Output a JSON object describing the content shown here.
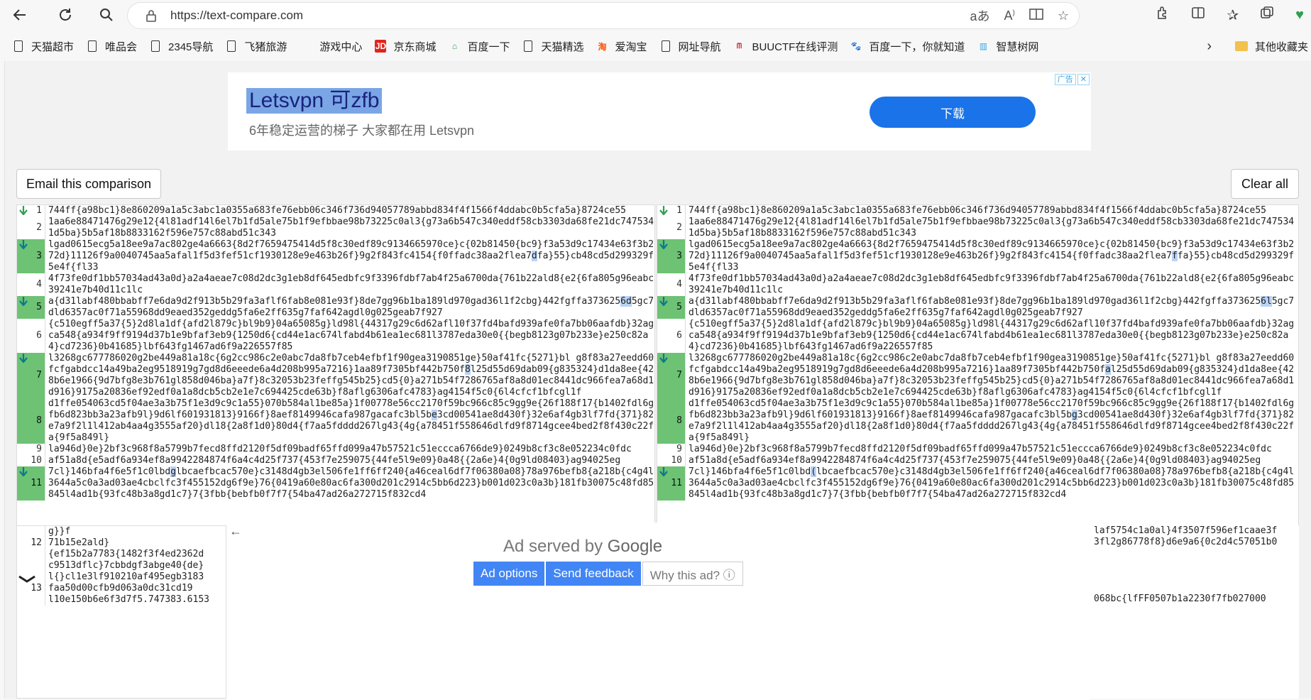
{
  "browser": {
    "url": "https://text-compare.com",
    "bookmarks": [
      "天猫超市",
      "唯品会",
      "2345导航",
      "飞猪旅游",
      "游戏中心",
      "京东商城",
      "百度一下",
      "天猫精选",
      "爱淘宝",
      "网址导航",
      "BUUCTF在线评测",
      "百度一下，你就知道",
      "智慧树网"
    ],
    "other_bookmarks": "其他收藏夹",
    "address_icons": [
      "read-aloud-icon",
      "font-icon",
      "split-screen-icon",
      "favorite-star-icon"
    ],
    "toolbar_icons": [
      "extensions-icon",
      "split-view-icon",
      "favorites-icon",
      "collections-icon",
      "performance-icon"
    ]
  },
  "top_ad": {
    "title": "Letsvpn 可zfb",
    "subtitle": "6年稳定运营的梯子 大家都在用 Letsvpn",
    "button": "下载",
    "badge": "广告"
  },
  "buttons": {
    "email": "Email this comparison",
    "clear": "Clear all"
  },
  "diff": {
    "left": [
      {
        "n": "1",
        "changed": false,
        "arrow": "down",
        "pre": "744ff{a98bc1}8e860209a1a5c3abc1a0355a683fe76ebb06c346f736d94057789abbd834f4f1566f4ddabc0b5cfa5a}8724ce55",
        "hl": "",
        "post": ""
      },
      {
        "n": "2",
        "changed": false,
        "arrow": "",
        "pre": "1aa6e88471476g29e12{4l81adf14l6el7b1fd5ale75b1f9efbbae98b73225c0al3{g73a6b547c340eddf58cb3303da68fe21dc7475341d5ba}5b5af18b8833162f596e757c88abd51c343",
        "hl": "",
        "post": ""
      },
      {
        "n": "3",
        "changed": true,
        "arrow": "down",
        "pre": "lgad0615ecg5a18ee9a7ac802ge4a6663{8d2f7659475414d5f8c30edf89c9134665970ce}c{02b81450{bc9}f3a53d9c17434e63f3b272d}11126f9a0040745aa5afal1f5d3fef51cf1930128e9e463b26f}9g2f843fc4154{f0ffadc38aa2flea7",
        "hl": "d",
        "post": "fa}55}cb48cd5d299329f5e4f{fl33"
      },
      {
        "n": "4",
        "changed": false,
        "arrow": "",
        "pre": "4f73fe0df1bb57034ad43a0d}a2a4aeae7c08d2dc3g1eb8df645edbfc9f3396fdbf7ab4f25a6700da{761b22ald8{e2{6fa805g96eabc39241e7b40d11c1lc",
        "hl": "",
        "post": ""
      },
      {
        "n": "5",
        "changed": true,
        "arrow": "down",
        "pre": "a{d31labf480bbabff7e6da9d2f913b5b29fa3aflf6fab8e081e93f}8de7gg96b1ba189ld970gad36l1f2cbg}442fgffa373625",
        "hl": "6d",
        "post": "5gc7dld6357ac0f71a55968dd9eaed352geddg5fa6e2ff635g7faf642agdl0g025geab7f927"
      },
      {
        "n": "6",
        "changed": false,
        "arrow": "",
        "pre": "{c510egff5a37{5}2d8la1df{afd2l879c}bl9b9}04a65085g}ld98l{44317g29c6d62afl10f37fd4bafd939afe0fa7bb06aafdb}32agca548{a934f9ff9194d37b1e9bfaf3eb9{1250d6{cd44e1ac674lfabd4b61ea1ec681l3787eda30e0{{begb8123g07b233e}e250c82a4}cd7236}0b41685}lbf643fg1467ad6f9a226557f85",
        "hl": "",
        "post": ""
      },
      {
        "n": "7",
        "changed": true,
        "arrow": "down",
        "pre": "l3268gc677786020g2be449a81a18c{6g2cc986c2e0abc7da8fb7ceb4efbf1f90gea3190851ge}50af41fc{5271}bl g8f83a27eedd60fcfgabdcc14a49ba2eg9518919g7gd8d6eeede6a4d208b995a7216}1aa89f7305bf442b750f",
        "hl": "8",
        "post": "l25d55d69dab09{g835324}d1da8ee{428b6e1966{9d7bfg8e3b761gl858d046ba}a7f}8c32053b23feffg545b25}cd5{0}a271b54f7286765af8a8d01ec8441dc966fea7a68d1d916}9175a20836ef92edf0a1a8dcb5cb2e1e7c694425cde63b}f8aflg6306afc4783}ag4154f5c0{6l4cfcf1bfcgl1f"
      },
      {
        "n": "8",
        "changed": true,
        "arrow": "",
        "pre": "d1ffe054063cd5f04ae3a3b75f1e3d9c9c1a55}070b584al1be85a}1f00778e56cc2170f59bc966c85c9gg9e{26f188f17{b1402fdl6gfb6d823bb3a23afb9l}9d6lf601931813}9166f}8aef8149946cafa987gacafc3bl5b",
        "hl": "e",
        "post": "3cd00541ae8d430f}32e6af4gb3lf7fd{371}82e7a9f2l1l412ab4aa4g3555af20}dl18{2a8f1d0}80d4{f7aa5fdddd267lg43{4g{a78451f558646dlfd9f8714gcee4bed2f8f430c22fa{9f5a849l}"
      },
      {
        "n": "9",
        "changed": false,
        "arrow": "",
        "pre": "la946d}0e}2bf3c968f8a5799b7fecd8ffd2120f5df09badf65ffd099a47b57521c51eccca6766de9}0249b8cf3c8e052234c0fdc",
        "hl": "",
        "post": ""
      },
      {
        "n": "10",
        "changed": false,
        "arrow": "",
        "pre": "af51a8d{e5adf6a934ef8a9942284874f6a4c4d25f737{453f7e259075{44fe5l9e09}0a48{{2a6e}4{0g9ld08403}ag94025eg",
        "hl": "",
        "post": ""
      },
      {
        "n": "11",
        "changed": true,
        "arrow": "down",
        "pre": "7cl}146bfa4f6e5f1c0lbd",
        "hl": "g",
        "post": "lbcaefbcac570e}c3148d4gb3el506fe1ff6ff240{a46ceal6df7f06380a08}78a976befb8{a218b{c4g4l3644a5c0a3ad03ae4cbclfc3f455152dg6f9e}76{0419a60e80ac6fa300d201c2914c5bb6d223}b001d023c0a3b}181fb30075c48fd85845l4ad1b{93fc48b3a8gd1c7}7{3fbb{bebfb0f7f7{54ba47ad26a272715f832cd4"
      }
    ],
    "right": [
      {
        "n": "1",
        "changed": false,
        "arrow": "down",
        "pre": "744ff{a98bc1}8e860209a1a5c3abc1a0355a683fe76ebb06c346f736d94057789abbd834f4f1566f4ddabc0b5cfa5a}8724ce55",
        "hl": "",
        "post": ""
      },
      {
        "n": "2",
        "changed": false,
        "arrow": "",
        "pre": "1aa6e88471476g29e12{4l81adf14l6el7b1fd5ale75b1f9efbbae98b73225c0al3{g73a6b547c340eddf58cb3303da68fe21dc7475341d5ba}5b5af18b8833162f596e757c88abd51c343",
        "hl": "",
        "post": ""
      },
      {
        "n": "3",
        "changed": true,
        "arrow": "down",
        "pre": "lgad0615ecg5a18ee9a7ac802ge4a6663{8d2f7659475414d5f8c30edf89c9134665970ce}c{02b81450{bc9}f3a53d9c17434e63f3b272d}11126f9a0040745aa5afal1f5d3fef51cf1930128e9e463b26f}9g2f843fc4154{f0ffadc38aa2flea7",
        "hl": "f",
        "post": "fa}55}cb48cd5d299329f5e4f{fl33"
      },
      {
        "n": "4",
        "changed": false,
        "arrow": "",
        "pre": "4f73fe0df1bb57034ad43a0d}a2a4aeae7c08d2dc3g1eb8df645edbfc9f3396fdbf7ab4f25a6700da{761b22ald8{e2{6fa805g96eabc39241e7b40d11c1lc",
        "hl": "",
        "post": ""
      },
      {
        "n": "5",
        "changed": true,
        "arrow": "down",
        "pre": "a{d31labf480bbabff7e6da9d2f913b5b29fa3aflf6fab8e081e93f}8de7gg96b1ba189ld970gad36l1f2cbg}442fgffa373625",
        "hl": "6l",
        "post": "5gc7dld6357ac0f71a55968dd9eaed352geddg5fa6e2ff635g7faf642agdl0g025geab7f927"
      },
      {
        "n": "6",
        "changed": false,
        "arrow": "",
        "pre": "{c510egff5a37{5}2d8la1df{afd2l879c}bl9b9}04a65085g}ld98l{44317g29c6d62afl10f37fd4bafd939afe0fa7bb06aafdb}32agca548{a934f9ff9194d37b1e9bfaf3eb9{1250d6{cd44e1ac674lfabd4b61ea1ec681l3787eda30e0{{begb8123g07b233e}e250c82a4}cd7236}0b41685}lbf643fg1467ad6f9a226557f85",
        "hl": "",
        "post": ""
      },
      {
        "n": "7",
        "changed": true,
        "arrow": "down",
        "pre": "l3268gc677786020g2be449a81a18c{6g2cc986c2e0abc7da8fb7ceb4efbf1f90gea3190851ge}50af41fc{5271}bl g8f83a27eedd60fcfgabdcc14a49ba2eg9518919g7gd8d6eeede6a4d208b995a7216}1aa89f7305bf442b750f",
        "hl": "a",
        "post": "l25d55d69dab09{g835324}d1da8ee{428b6e1966{9d7bfg8e3b761gl858d046ba}a7f}8c32053b23feffg545b25}cd5{0}a271b54f7286765af8a8d01ec8441dc966fea7a68d1d916}9175a20836ef92edf0a1a8dcb5cb2e1e7c694425cde63b}f8aflg6306afc4783}ag4154f5c0{6l4cfcf1bfcgl1f"
      },
      {
        "n": "8",
        "changed": true,
        "arrow": "",
        "pre": "d1ffe054063cd5f04ae3a3b75f1e3d9c9c1a55}070b584al1be85a}1f00778e56cc2170f59bc966c85c9gg9e{26f188f17{b1402fdl6gfb6d823bb3a23afb9l}9d6lf601931813}9166f}8aef8149946cafa987gacafc3bl5b",
        "hl": "g",
        "post": "3cd00541ae8d430f}32e6af4gb3lf7fd{371}82e7a9f2l1l412ab4aa4g3555af20}dl18{2a8f1d0}80d4{f7aa5fdddd267lg43{4g{a78451f558646dlfd9f8714gcee4bed2f8f430c22fa{9f5a849l}"
      },
      {
        "n": "9",
        "changed": false,
        "arrow": "",
        "pre": "la946d}0e}2bf3c968f8a5799b7fecd8ffd2120f5df09badf65ffd099a47b57521c51eccca6766de9}0249b8cf3c8e052234c0fdc",
        "hl": "",
        "post": ""
      },
      {
        "n": "10",
        "changed": false,
        "arrow": "",
        "pre": "af51a8d{e5adf6a934ef8a9942284874f6a4c4d25f737{453f7e259075{44fe5l9e09}0a48{{2a6e}4{0g9ld08403}ag94025eg",
        "hl": "",
        "post": ""
      },
      {
        "n": "11",
        "changed": true,
        "arrow": "down",
        "pre": "7cl}146bfa4f6e5f1c0lbd",
        "hl": "(",
        "post": "lbcaefbcac570e}c3148d4gb3el506fe1ff6ff240{a46ceal6df7f06380a08}78a976befb8{a218b{c4g4l3644a5c0a3ad03ae4cbclfc3f455152dg6f9e}76{0419a60e80ac6fa300d201c2914c5bb6d223}b001d023c0a3b}181fb30075c48fd85845l4ad1b{93fc48b3a8gd1c7}7{3fbb{bebfb0f7f7{54ba47ad26a272715f832cd4"
      }
    ]
  },
  "under_left": [
    {
      "n": "",
      "t": "g}}f"
    },
    {
      "n": "12",
      "t": "71b15e2ald}"
    },
    {
      "n": "",
      "t": "{ef15b2a7783{1482f3f4ed2362d"
    },
    {
      "n": "",
      "t": "c9513dflc}7cbbdgf3abge40{de}"
    },
    {
      "n": "",
      "t": "l{}cl1e3lf910210af495egb3183"
    },
    {
      "n": "13",
      "t": "faa50d00cfb9d063a0dc31cd19"
    },
    {
      "n": "",
      "t": "l10e150b6e6f3d7f5.747383.6153"
    }
  ],
  "under_right": [
    "laf5754c1a0al}4f3507f596ef1caae3f",
    "3fl2g86778f8}d6e9a6{0c2d4c57051b0",
    "",
    "",
    "",
    "",
    "068bc{lfFF0507b1a2230f7fb027000"
  ],
  "bottom_ad": {
    "served_by": "Ad served by",
    "brand": "Google",
    "ad_options": "Ad options",
    "send_feedback": "Send feedback",
    "why_this_ad": "Why this ad? ⓘ"
  }
}
